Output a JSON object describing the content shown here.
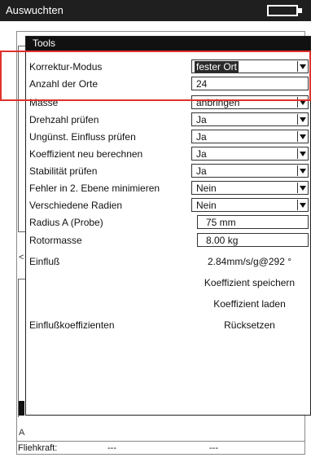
{
  "titlebar": {
    "title": "Auswuchten"
  },
  "dialog": {
    "title": "Tools",
    "rows": [
      {
        "label": "Korrektur-Modus",
        "value": "fester Ort",
        "type": "select",
        "selected": true
      },
      {
        "label": "Anzahl der Orte",
        "value": "24",
        "type": "number"
      },
      {
        "label": "Masse",
        "value": "anbringen",
        "type": "select"
      },
      {
        "label": "Drehzahl prüfen",
        "value": "Ja",
        "type": "select"
      },
      {
        "label": "Ungünst. Einfluss prüfen",
        "value": "Ja",
        "type": "select"
      },
      {
        "label": "Koeffizient neu berechnen",
        "value": "Ja",
        "type": "select"
      },
      {
        "label": "Stabilität prüfen",
        "value": "Ja",
        "type": "select"
      },
      {
        "label": "Fehler in 2. Ebene minimieren",
        "value": "Nein",
        "type": "select"
      },
      {
        "label": "Verschiedene Radien",
        "value": "Nein",
        "type": "select"
      },
      {
        "label": "Radius A (Probe)",
        "value": "75 mm",
        "type": "number"
      },
      {
        "label": "Rotormasse",
        "value": "8.00 kg",
        "type": "number"
      }
    ],
    "einfluss_label": "Einfluß",
    "einfluss_value": "2.84mm/s/g@292 °",
    "save_coeff": "Koeffizient speichern",
    "load_coeff": "Koeffizient laden",
    "coeff_label": "Einflußkoeffizienten",
    "reset": "Rücksetzen"
  },
  "background": {
    "bottom_label": "Fliehkraft:",
    "bottom_val1": "---",
    "bottom_val2": "---",
    "side_glyph_1": "<",
    "side_glyph_2": "A"
  },
  "colors": {
    "highlight": "#e0302c",
    "titlebar": "#1f1f1f"
  }
}
